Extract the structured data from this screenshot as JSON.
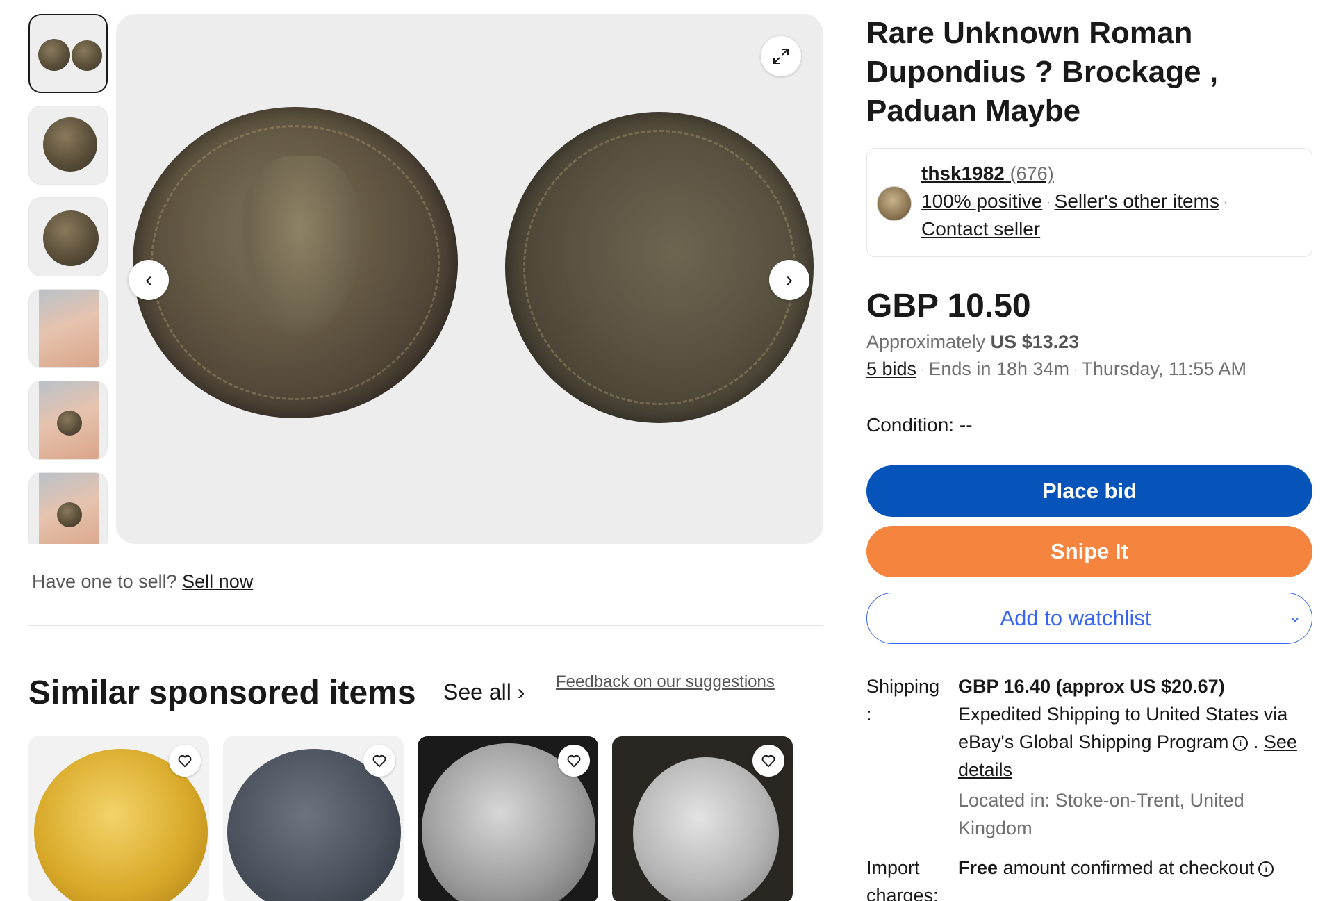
{
  "gallery": {
    "thumbnails": [
      "thumb-1",
      "thumb-2",
      "thumb-3",
      "thumb-4",
      "thumb-5",
      "thumb-6"
    ],
    "selected_index": 0,
    "prev_icon": "‹",
    "next_icon": "›",
    "expand_icon": "expand-icon"
  },
  "sell": {
    "prompt": "Have one to sell?",
    "link": "Sell now"
  },
  "similar": {
    "title": "Similar sponsored items",
    "see_all": "See all",
    "feedback": "Feedback on our suggestions",
    "cards": [
      {
        "label": "gold-coin-card"
      },
      {
        "label": "dark-coin-card"
      },
      {
        "label": "silver-coin-card"
      },
      {
        "label": "elephant-coin-card"
      }
    ]
  },
  "listing": {
    "title": "Rare Unknown Roman Dupondius ? Brockage , Paduan Maybe",
    "seller": {
      "name": "thsk1982",
      "count": "(676)",
      "positive": "100% positive",
      "other_items": "Seller's other items",
      "contact": "Contact seller"
    },
    "price": "GBP 10.50",
    "approx_prefix": "Approximately",
    "approx_value": "US $13.23",
    "bids": "5 bids",
    "ends": "Ends in 18h 34m",
    "end_time": "Thursday, 11:55 AM",
    "condition_label": "Condition:",
    "condition_value": "--",
    "place_bid": "Place bid",
    "snipe": "Snipe It",
    "watchlist": "Add to watchlist",
    "shipping": {
      "label": "Shipping\n:",
      "price": "GBP 16.40 (approx US $20.67)",
      "desc": "Expedited Shipping to United States via eBay's Global Shipping Program",
      "see_details": "See details",
      "location": "Located in: Stoke-on-Trent, United Kingdom"
    },
    "import": {
      "label": "Import charges:",
      "free": "Free",
      "text": "amount confirmed at checkout"
    }
  },
  "colors": {
    "primary_blue": "#0654ba",
    "snipe_orange": "#f5843f",
    "watch_blue": "#3665f3",
    "text": "#191919",
    "muted": "#707070"
  }
}
